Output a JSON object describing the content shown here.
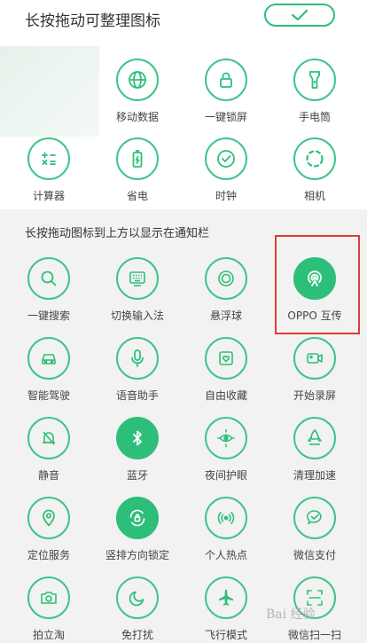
{
  "header": {
    "title": "长按拖动可整理图标",
    "confirm_icon": "check-icon"
  },
  "top_tiles": [
    {
      "label": "移动数据",
      "icon": "globe-icon"
    },
    {
      "label": "一键锁屏",
      "icon": "lock-icon"
    },
    {
      "label": "手电筒",
      "icon": "flashlight-icon"
    },
    {
      "label": "计算器",
      "icon": "calculator-icon"
    },
    {
      "label": "省电",
      "icon": "battery-icon"
    },
    {
      "label": "时钟",
      "icon": "clock-icon"
    },
    {
      "label": "相机",
      "icon": "camera-ring-icon"
    }
  ],
  "section": {
    "title": "长按拖动图标到上方以显示在通知栏"
  },
  "bottom_tiles": [
    {
      "label": "一键搜索",
      "icon": "search-icon"
    },
    {
      "label": "切换输入法",
      "icon": "keyboard-icon"
    },
    {
      "label": "悬浮球",
      "icon": "floating-ball-icon"
    },
    {
      "label": "OPPO 互传",
      "icon": "oppo-share-icon"
    },
    {
      "label": "智能驾驶",
      "icon": "car-icon"
    },
    {
      "label": "语音助手",
      "icon": "microphone-icon"
    },
    {
      "label": "自由收藏",
      "icon": "heart-folder-icon"
    },
    {
      "label": "开始录屏",
      "icon": "video-icon"
    },
    {
      "label": "静音",
      "icon": "bell-off-icon"
    },
    {
      "label": "蓝牙",
      "icon": "bluetooth-icon"
    },
    {
      "label": "夜间护眼",
      "icon": "eye-sun-icon"
    },
    {
      "label": "清理加速",
      "icon": "rocket-icon"
    },
    {
      "label": "定位服务",
      "icon": "location-pin-icon"
    },
    {
      "label": "竖排方向锁定",
      "icon": "rotation-lock-icon"
    },
    {
      "label": "个人热点",
      "icon": "hotspot-icon"
    },
    {
      "label": "微信支付",
      "icon": "wechat-pay-icon"
    },
    {
      "label": "拍立淘",
      "icon": "camera-icon"
    },
    {
      "label": "免打扰",
      "icon": "moon-icon"
    },
    {
      "label": "飞行模式",
      "icon": "airplane-icon"
    },
    {
      "label": "微信扫一扫",
      "icon": "scan-icon"
    }
  ],
  "watermark": "Bai 经验",
  "colors": {
    "accent": "#2dbf7a",
    "highlight": "#e53935",
    "lower_bg": "#f2f2f2"
  }
}
